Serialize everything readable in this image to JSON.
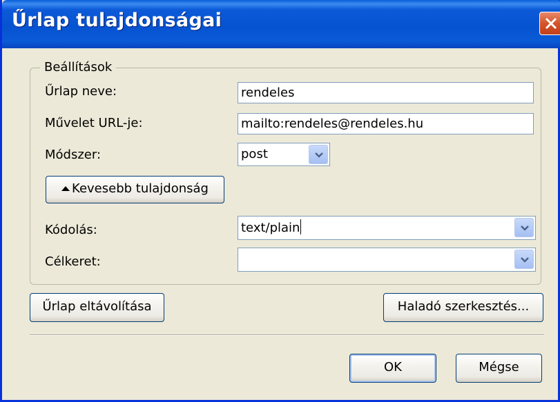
{
  "window": {
    "title": "Űrlap tulajdonságai"
  },
  "settings_group": {
    "legend": "Beállítások"
  },
  "form_name": {
    "label": "Űrlap neve:",
    "value": "rendeles"
  },
  "action_url": {
    "label": "Művelet URL-je:",
    "value": "mailto:rendeles@rendeles.hu"
  },
  "method": {
    "label": "Módszer:",
    "value": "post"
  },
  "less_properties_button": {
    "label": "Kevesebb tulajdonság"
  },
  "encoding": {
    "label": "Kódolás:",
    "value": "text/plain"
  },
  "target": {
    "label": "Célkeret:",
    "value": ""
  },
  "remove_form_button": {
    "label": "Űrlap eltávolítása"
  },
  "advanced_edit_button": {
    "label": "Haladó szerkesztés..."
  },
  "ok_button": {
    "label": "OK"
  },
  "cancel_button": {
    "label": "Mégse"
  }
}
